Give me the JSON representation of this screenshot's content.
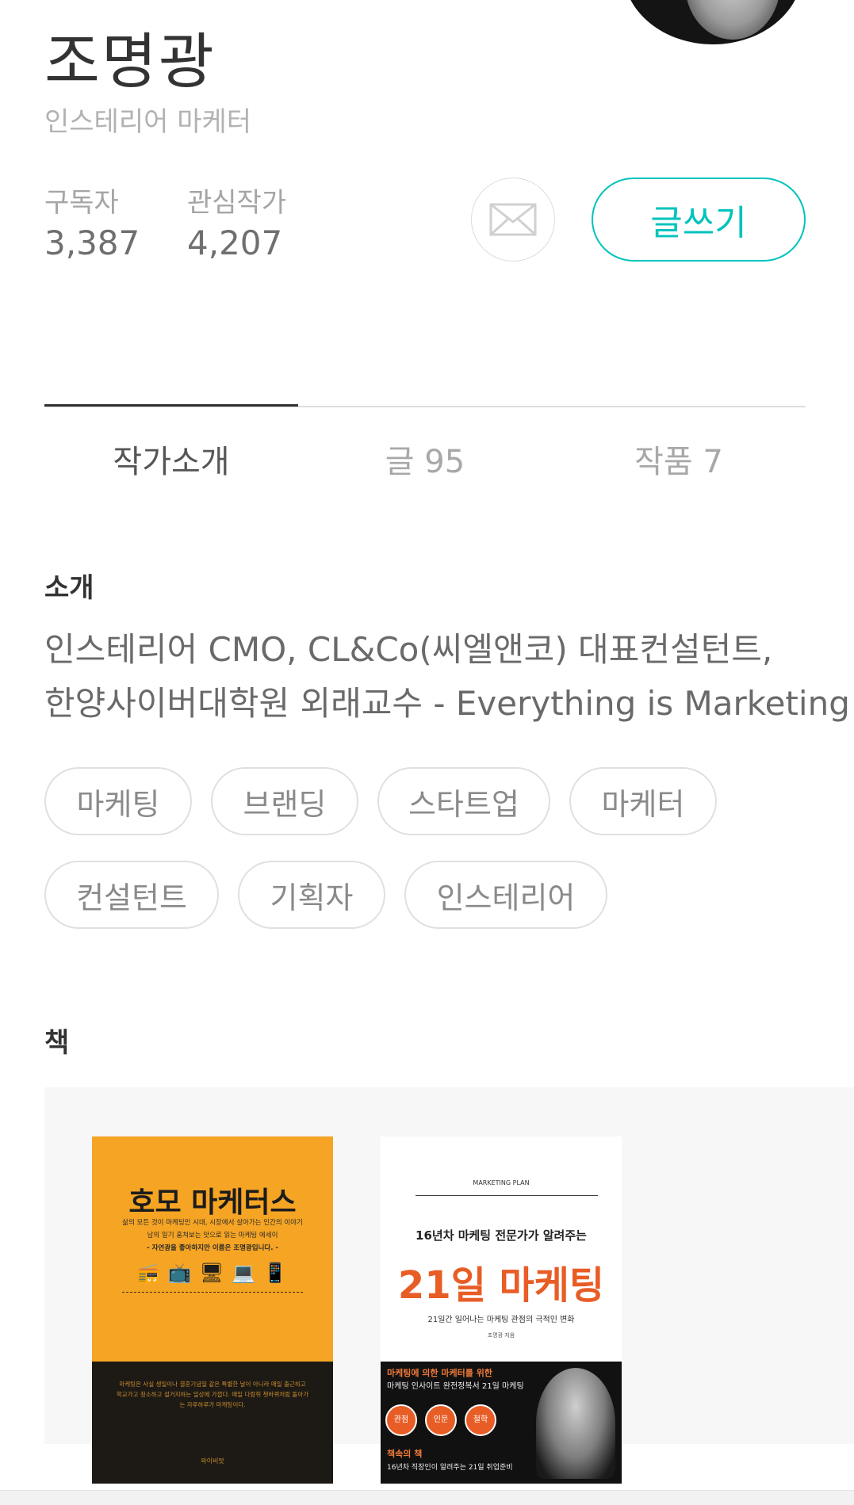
{
  "profile": {
    "name": "조명광",
    "subtitle": "인스테리어 마케터",
    "subscribers_label": "구독자",
    "subscribers_value": "3,387",
    "following_label": "관심작가",
    "following_value": "4,207",
    "write_label": "글쓰기"
  },
  "tabs": [
    {
      "label": "작가소개"
    },
    {
      "label": "글 95"
    },
    {
      "label": "작품 7"
    }
  ],
  "intro": {
    "title": "소개",
    "line1": "인스테리어 CMO, CL&Co(씨엘앤코) 대표컨설턴트,",
    "line2": "한양사이버대학원 외래교수 - Everything is Marketing"
  },
  "tags": [
    "마케팅",
    "브랜딩",
    "스타트업",
    "마케터",
    "컨설턴트",
    "기획자",
    "인스테리어"
  ],
  "books": {
    "title": "책",
    "book1": {
      "title": "호모 마케터스",
      "line1": "삶의 모든 것이 마케팅인 시대, 시장에서 살아가는 인간의 이야기",
      "line2": "남의 일기 훔쳐보는 맛으로 읽는 마케팅 에세이",
      "line3": "- 자연광을 좋아하지만 이름은 조명광입니다. -",
      "blurb": "마케팅은 사실 생일이나 결혼기념일 같은 특별한 날이 아니라 매일 출근하고 학교가고 청소하고 설거지하는 일상에 가깝다. 매일 다람쥐 쳇바퀴처럼 돌아가는 자루하루가 마케팅이다.",
      "publisher": "와이비맛"
    },
    "book2": {
      "plan_label": "MARKETING PLAN",
      "subtitle": "16년차 마케팅 전문가가 알려주는",
      "title": "21일 마케팅",
      "desc": "21일간 일어나는 마케팅 관점의 극적인 변화",
      "author": "조명광 지음",
      "banner1": "마케팅에 의한 마케터를 위한",
      "banner2": "마케팅 인사이트 완전정복서 21일 마케팅",
      "circles": [
        "관점",
        "인문",
        "철학"
      ],
      "banner3": "책속의 책",
      "banner4": "16년차 직장인이 알려주는 21일 취업준비"
    }
  }
}
